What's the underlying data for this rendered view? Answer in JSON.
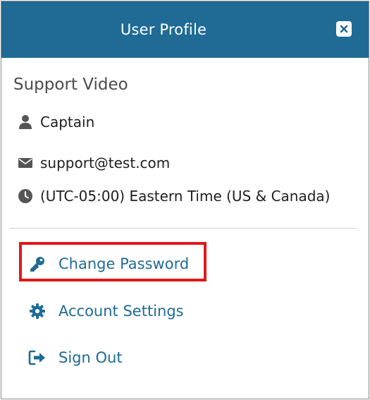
{
  "header": {
    "title": "User Profile",
    "close_icon": "close-icon"
  },
  "profile": {
    "name": "Support Video",
    "role": "Captain",
    "email": "support@test.com",
    "timezone": "(UTC-05:00) Eastern Time (US & Canada)"
  },
  "icons": {
    "role": "person-icon",
    "email": "envelope-icon",
    "timezone": "clock-icon"
  },
  "menu": {
    "items": [
      {
        "label": "Change Password",
        "icon": "key-icon",
        "highlighted": true
      },
      {
        "label": "Account Settings",
        "icon": "gear-icon",
        "highlighted": false
      },
      {
        "label": "Sign Out",
        "icon": "sign-out-icon",
        "highlighted": false
      }
    ]
  },
  "colors": {
    "header_bg": "#1f6b95",
    "accent": "#1f6b95",
    "highlight_border": "#e0181b",
    "icon_gray": "#555555"
  }
}
